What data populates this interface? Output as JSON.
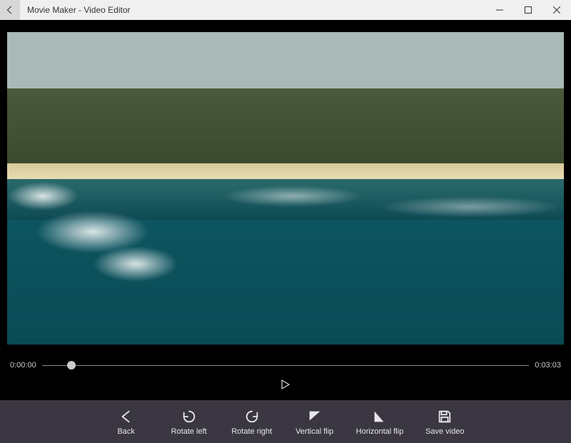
{
  "window": {
    "title": "Movie Maker - Video Editor"
  },
  "playback": {
    "current_time": "0:00:00",
    "total_time": "0:03:03",
    "progress_percent": 6
  },
  "toolbar": {
    "back": "Back",
    "rotate_left": "Rotate left",
    "rotate_right": "Rotate right",
    "vertical_flip": "Vertical flip",
    "horizontal_flip": "Horizontal flip",
    "save_video": "Save video"
  }
}
